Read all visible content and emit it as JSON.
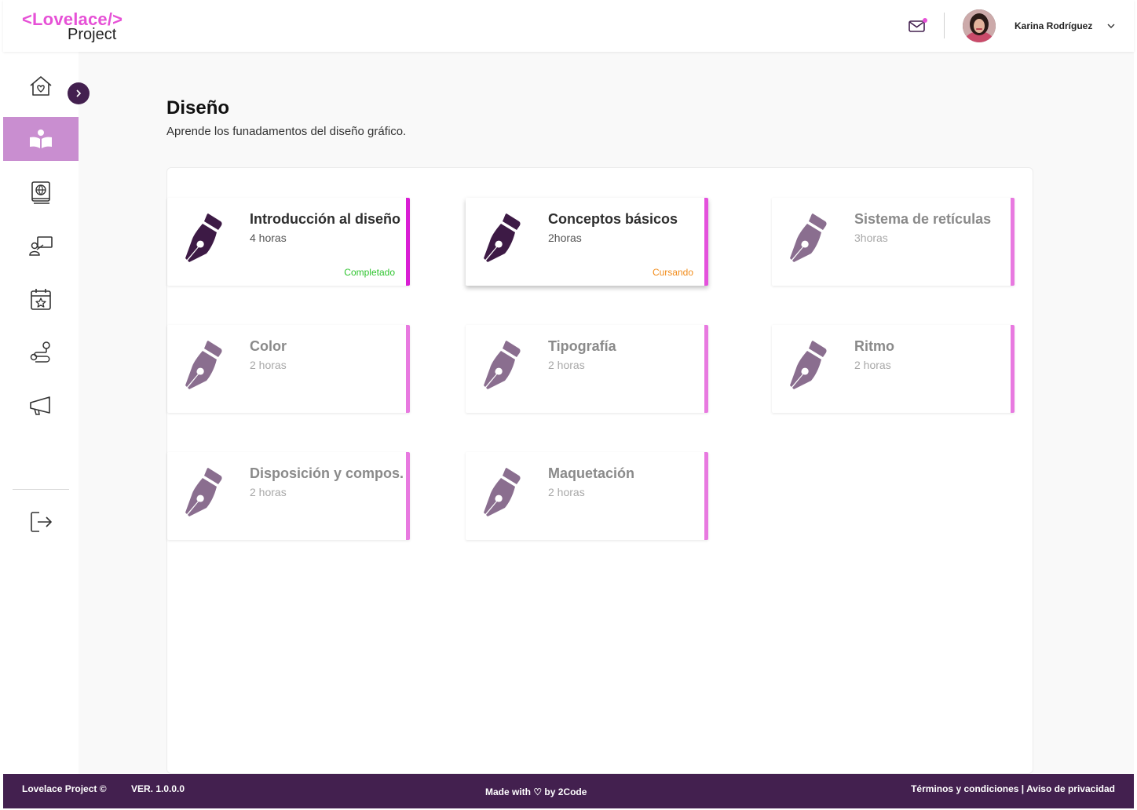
{
  "header": {
    "logo_top": "<Lovelace/>",
    "logo_bottom": "Project",
    "mail_icon": "mail-icon",
    "user_name": "Karina Rodríguez"
  },
  "sidebar": {
    "items": [
      {
        "icon": "home-heart-icon",
        "active": false
      },
      {
        "icon": "book-reader-icon",
        "active": true
      },
      {
        "icon": "globe-book-icon",
        "active": false
      },
      {
        "icon": "teacher-board-icon",
        "active": false
      },
      {
        "icon": "calendar-star-icon",
        "active": false
      },
      {
        "icon": "route-icon",
        "active": false
      },
      {
        "icon": "megaphone-icon",
        "active": false
      },
      {
        "icon": "logout-icon",
        "active": false
      }
    ]
  },
  "page": {
    "title": "Diseño",
    "subtitle": "Aprende los funadamentos del diseño gráfico."
  },
  "courses": [
    {
      "name": "Introducción al diseño",
      "duration": "4 horas",
      "status": "Completado",
      "status_color": "#2ec42e",
      "locked": false
    },
    {
      "name": "Conceptos básicos",
      "duration": "2horas",
      "status": "Cursando",
      "status_color": "#f28c1a",
      "locked": false
    },
    {
      "name": "Sistema de retículas",
      "duration": "3horas",
      "status": "",
      "locked": true
    },
    {
      "name": "Color",
      "duration": "2 horas",
      "status": "",
      "locked": true
    },
    {
      "name": "Tipografía",
      "duration": "2 horas",
      "status": "",
      "locked": true
    },
    {
      "name": "Ritmo",
      "duration": "2 horas",
      "status": "",
      "locked": true
    },
    {
      "name": "Disposición y compos...",
      "duration": "2 horas",
      "status": "",
      "locked": true
    },
    {
      "name": "Maquetación",
      "duration": "2 horas",
      "status": "",
      "locked": true
    }
  ],
  "footer": {
    "copyright": "Lovelace Project ©",
    "version": "VER. 1.0.0.0",
    "made_with": "Made with ♡ by 2Code",
    "terms": "Términos y condiciones",
    "separator": " | ",
    "privacy": "Aviso de privacidad"
  },
  "colors": {
    "brand_pink": "#e651d6",
    "brand_purple": "#43204f",
    "active_nav": "#c98ed0",
    "icon_dark": "#3d1a45",
    "icon_locked": "#8a6e8f"
  }
}
